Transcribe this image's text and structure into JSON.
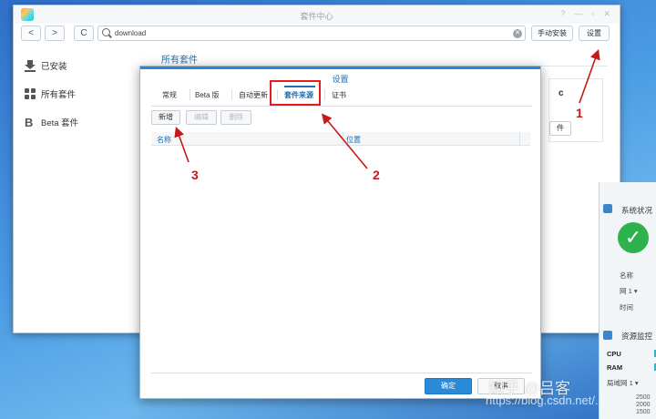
{
  "window": {
    "title": "套件中心",
    "controls": [
      "?",
      "—",
      "▫",
      "✕"
    ]
  },
  "toolbar": {
    "back": "<",
    "forward": ">",
    "refresh": "C",
    "search_value": "download",
    "manual_install_label": "手动安装",
    "settings_label": "设置"
  },
  "sidebar": {
    "items": [
      {
        "label": "已安装",
        "icon": "download-icon"
      },
      {
        "label": "所有套件",
        "icon": "grid-icon"
      },
      {
        "label": "Beta 套件",
        "icon": "beta-icon"
      }
    ]
  },
  "main": {
    "title": "所有套件",
    "card_letter": "c",
    "card_button": "件"
  },
  "dialog": {
    "title": "设置",
    "tabs": [
      "常规",
      "Beta 版",
      "自动更新",
      "套件来源",
      "证书"
    ],
    "active_tab": "套件来源",
    "actions": {
      "add": "新增",
      "edit": "编辑",
      "delete": "删除"
    },
    "columns": {
      "name": "名称",
      "location": "位置"
    },
    "ok_label": "确定",
    "cancel_label": "取消"
  },
  "right_panel": {
    "system_status_title": "系统状况",
    "name_label": "名称",
    "lan_label": "网 1 ▾",
    "time_label": "时间",
    "resource_title": "资源监控",
    "cpu_label": "CPU",
    "ram_label": "RAM",
    "lan2_label": "局域网 1 ▾",
    "values": [
      "2500",
      "2000",
      "1500"
    ]
  },
  "annotations": {
    "n1": "1",
    "n2": "2",
    "n3": "3",
    "color": "#c81818"
  },
  "watermark": {
    "text": "知乎 @吕客",
    "url": "https://blog.csdn.net/..."
  }
}
